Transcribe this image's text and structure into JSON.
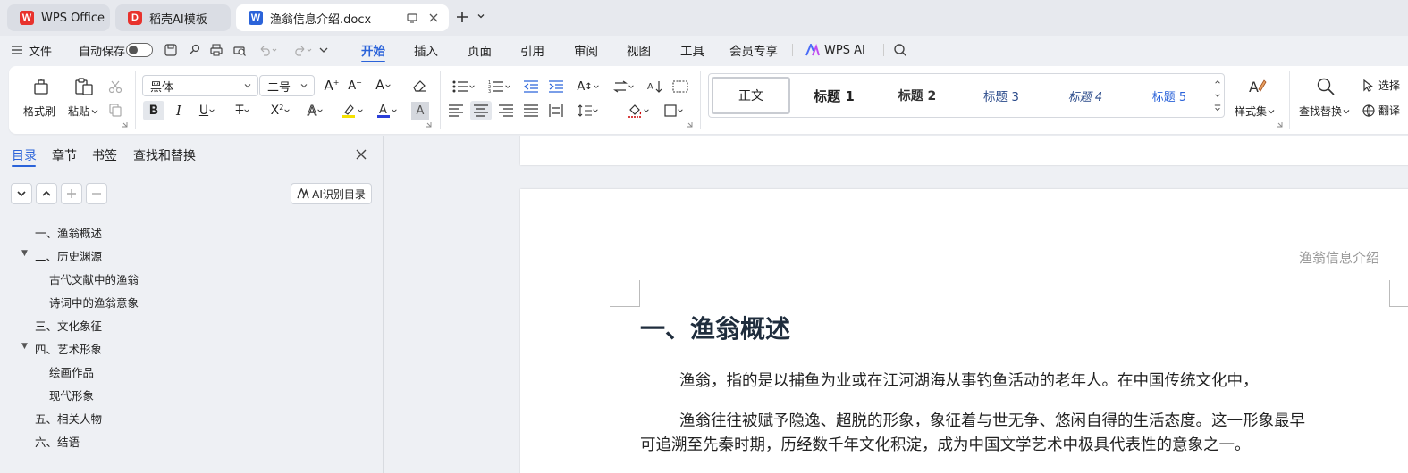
{
  "tabs": [
    {
      "label": "WPS Office",
      "logo": "W"
    },
    {
      "label": "稻壳AI模板",
      "logo": "D"
    },
    {
      "label": "渔翁信息介绍.docx",
      "logo": "W"
    }
  ],
  "menu": {
    "file": "文件",
    "autosave": "自动保存",
    "tabs": [
      "开始",
      "插入",
      "页面",
      "引用",
      "审阅",
      "视图",
      "工具",
      "会员专享"
    ],
    "active_tab": "开始",
    "wps_ai": "WPS AI"
  },
  "ribbon": {
    "format_painter": "格式刷",
    "paste": "粘贴",
    "font_name": "黑体",
    "font_size": "二号",
    "styles": [
      "正文",
      "标题 1",
      "标题 2",
      "标题 3",
      "标题 4",
      "标题 5"
    ],
    "style_set": "样式集",
    "find_replace": "查找替换",
    "select": "选择",
    "translate": "翻译"
  },
  "nav": {
    "tabs": [
      "目录",
      "章节",
      "书签",
      "查找和替换"
    ],
    "ai_toc": "AI识别目录",
    "toc": [
      {
        "text": "一、渔翁概述",
        "level": 1
      },
      {
        "text": "二、历史渊源",
        "level": 1,
        "expanded": true
      },
      {
        "text": "古代文献中的渔翁",
        "level": 2
      },
      {
        "text": "诗词中的渔翁意象",
        "level": 2
      },
      {
        "text": "三、文化象征",
        "level": 1
      },
      {
        "text": "四、艺术形象",
        "level": 1,
        "expanded": true
      },
      {
        "text": "绘画作品",
        "level": 2
      },
      {
        "text": "现代形象",
        "level": 2
      },
      {
        "text": "五、相关人物",
        "level": 1
      },
      {
        "text": "六、结语",
        "level": 1
      }
    ]
  },
  "document": {
    "header_text": "渔翁信息介绍",
    "heading": "一、渔翁概述",
    "para1": "渔翁，指的是以捕鱼为业或在江河湖海从事钓鱼活动的老年人。在中国传统文化中，",
    "para2_line1": "渔翁往往被赋予隐逸、超脱的形象，象征着与世无争、悠闲自得的生活态度。这一形象最早",
    "para2_line2": "可追溯至先秦时期，历经数千年文化积淀，成为中国文学艺术中极具代表性的意象之一。"
  },
  "colors": {
    "accent": "#2b63d9",
    "wps_red": "#e8322d",
    "heading_text": "#1f2d3d"
  }
}
